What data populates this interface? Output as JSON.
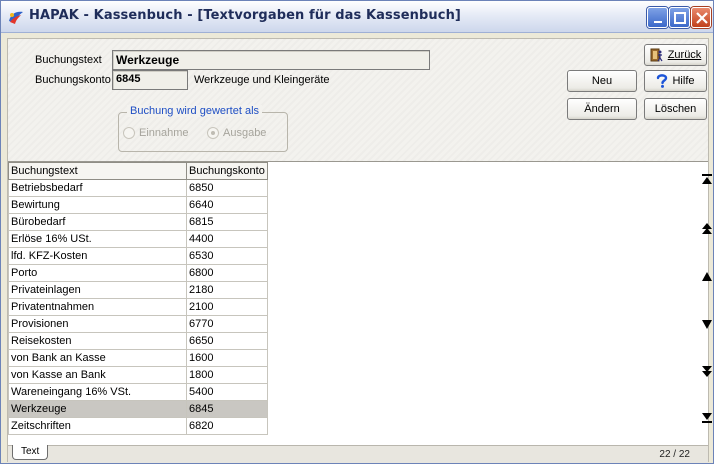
{
  "window": {
    "title": "HAPAK - Kassenbuch - [Textvorgaben für das Kassenbuch]"
  },
  "form": {
    "buchungstext_label": "Buchungstext",
    "buchungstext_value": "Werkzeuge",
    "buchungskonto_label": "Buchungskonto",
    "buchungskonto_value": "6845",
    "buchungskonto_desc": "Werkzeuge und Kleingeräte",
    "group_title": "Buchung wird gewertet als",
    "radio_einnahme": "Einnahme",
    "radio_ausgabe": "Ausgabe",
    "selected_radio": "Ausgabe"
  },
  "buttons": {
    "zurueck": "Zurück",
    "neu": "Neu",
    "hilfe": "Hilfe",
    "aendern": "Ändern",
    "loeschen": "Löschen"
  },
  "table": {
    "headers": [
      "Buchungstext",
      "Buchungskonto"
    ],
    "rows": [
      [
        "Betriebsbedarf",
        "6850"
      ],
      [
        "Bewirtung",
        "6640"
      ],
      [
        "Bürobedarf",
        "6815"
      ],
      [
        "Erlöse 16% USt.",
        "4400"
      ],
      [
        "lfd. KFZ-Kosten",
        "6530"
      ],
      [
        "Porto",
        "6800"
      ],
      [
        "Privateinlagen",
        "2180"
      ],
      [
        "Privatentnahmen",
        "2100"
      ],
      [
        "Provisionen",
        "6770"
      ],
      [
        "Reisekosten",
        "6650"
      ],
      [
        "von Bank an Kasse",
        "1600"
      ],
      [
        "von Kasse an Bank",
        "1800"
      ],
      [
        "Wareneingang 16% VSt.",
        "5400"
      ],
      [
        "Werkzeuge",
        "6845"
      ],
      [
        "Zeitschriften",
        "6820"
      ]
    ],
    "selected_row_index": 13
  },
  "status": {
    "tab_label": "Text",
    "counter": "22 / 22"
  },
  "colors": {
    "group_title": "#1f4fc4",
    "selected_row": "#c9c7c2"
  }
}
